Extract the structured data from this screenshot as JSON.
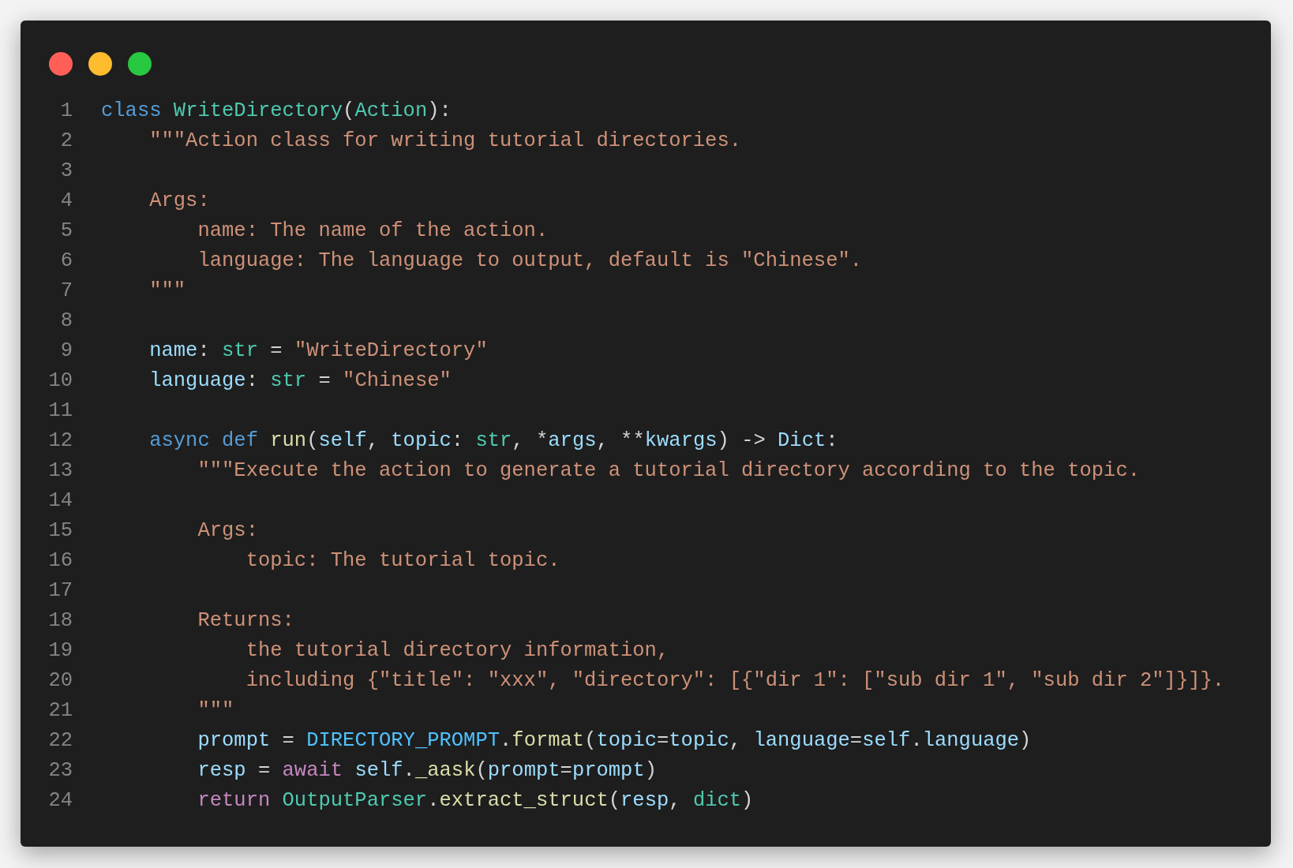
{
  "window": {
    "controls": [
      {
        "kind": "close"
      },
      {
        "kind": "minimize"
      },
      {
        "kind": "zoom"
      }
    ]
  },
  "lines": [
    {
      "number": "1",
      "tokens": [
        {
          "kind": "keyword",
          "text": "class "
        },
        {
          "kind": "class",
          "text": "WriteDirectory"
        },
        {
          "kind": "plain",
          "text": "("
        },
        {
          "kind": "class",
          "text": "Action"
        },
        {
          "kind": "plain",
          "text": "):"
        }
      ]
    },
    {
      "number": "2",
      "tokens": [
        {
          "kind": "string",
          "text": "    \"\"\"Action class for writing tutorial directories."
        }
      ]
    },
    {
      "number": "3"
    },
    {
      "number": "4",
      "tokens": [
        {
          "kind": "string",
          "text": "    Args:"
        }
      ]
    },
    {
      "number": "5",
      "tokens": [
        {
          "kind": "string",
          "text": "        name: The name of the action."
        }
      ]
    },
    {
      "number": "6",
      "tokens": [
        {
          "kind": "string",
          "text": "        language: The language to output, default is \"Chinese\"."
        }
      ]
    },
    {
      "number": "7",
      "tokens": [
        {
          "kind": "string",
          "text": "    \"\"\""
        }
      ]
    },
    {
      "number": "8"
    },
    {
      "number": "9",
      "tokens": [
        {
          "kind": "variable",
          "text": "    name"
        },
        {
          "kind": "plain",
          "text": ": "
        },
        {
          "kind": "type",
          "text": "str"
        },
        {
          "kind": "plain",
          "text": " = "
        },
        {
          "kind": "string",
          "text": "\"WriteDirectory\""
        }
      ]
    },
    {
      "number": "10",
      "tokens": [
        {
          "kind": "variable",
          "text": "    language"
        },
        {
          "kind": "plain",
          "text": ": "
        },
        {
          "kind": "type",
          "text": "str"
        },
        {
          "kind": "plain",
          "text": " = "
        },
        {
          "kind": "string",
          "text": "\"Chinese\""
        }
      ]
    },
    {
      "number": "11"
    },
    {
      "number": "12",
      "tokens": [
        {
          "kind": "keyword",
          "text": "    async def "
        },
        {
          "kind": "function",
          "text": "run"
        },
        {
          "kind": "plain",
          "text": "("
        },
        {
          "kind": "variable",
          "text": "self"
        },
        {
          "kind": "plain",
          "text": ", "
        },
        {
          "kind": "variable",
          "text": "topic"
        },
        {
          "kind": "plain",
          "text": ": "
        },
        {
          "kind": "type",
          "text": "str"
        },
        {
          "kind": "plain",
          "text": ", *"
        },
        {
          "kind": "variable",
          "text": "args"
        },
        {
          "kind": "plain",
          "text": ", **"
        },
        {
          "kind": "variable",
          "text": "kwargs"
        },
        {
          "kind": "plain",
          "text": ") -> "
        },
        {
          "kind": "variable",
          "text": "Dict"
        },
        {
          "kind": "plain",
          "text": ":"
        }
      ]
    },
    {
      "number": "13",
      "tokens": [
        {
          "kind": "string",
          "text": "        \"\"\"Execute the action to generate a tutorial directory according to the topic."
        }
      ]
    },
    {
      "number": "14"
    },
    {
      "number": "15",
      "tokens": [
        {
          "kind": "string",
          "text": "        Args:"
        }
      ]
    },
    {
      "number": "16",
      "tokens": [
        {
          "kind": "string",
          "text": "            topic: The tutorial topic."
        }
      ]
    },
    {
      "number": "17"
    },
    {
      "number": "18",
      "tokens": [
        {
          "kind": "string",
          "text": "        Returns:"
        }
      ]
    },
    {
      "number": "19",
      "tokens": [
        {
          "kind": "string",
          "text": "            the tutorial directory information,"
        }
      ]
    },
    {
      "number": "20",
      "tokens": [
        {
          "kind": "string",
          "text": "            including {\"title\": \"xxx\", \"directory\": [{\"dir 1\": [\"sub dir 1\", \"sub dir 2\"]}]}."
        }
      ]
    },
    {
      "number": "21",
      "tokens": [
        {
          "kind": "string",
          "text": "        \"\"\""
        }
      ]
    },
    {
      "number": "22",
      "tokens": [
        {
          "kind": "variable",
          "text": "        prompt"
        },
        {
          "kind": "plain",
          "text": " = "
        },
        {
          "kind": "constant",
          "text": "DIRECTORY_PROMPT"
        },
        {
          "kind": "plain",
          "text": "."
        },
        {
          "kind": "function",
          "text": "format"
        },
        {
          "kind": "plain",
          "text": "("
        },
        {
          "kind": "variable",
          "text": "topic"
        },
        {
          "kind": "plain",
          "text": "="
        },
        {
          "kind": "variable",
          "text": "topic"
        },
        {
          "kind": "plain",
          "text": ", "
        },
        {
          "kind": "variable",
          "text": "language"
        },
        {
          "kind": "plain",
          "text": "="
        },
        {
          "kind": "variable",
          "text": "self"
        },
        {
          "kind": "plain",
          "text": "."
        },
        {
          "kind": "variable",
          "text": "language"
        },
        {
          "kind": "plain",
          "text": ")"
        }
      ]
    },
    {
      "number": "23",
      "tokens": [
        {
          "kind": "variable",
          "text": "        resp"
        },
        {
          "kind": "plain",
          "text": " = "
        },
        {
          "kind": "control",
          "text": "await "
        },
        {
          "kind": "variable",
          "text": "self"
        },
        {
          "kind": "plain",
          "text": "."
        },
        {
          "kind": "function",
          "text": "_aask"
        },
        {
          "kind": "plain",
          "text": "("
        },
        {
          "kind": "variable",
          "text": "prompt"
        },
        {
          "kind": "plain",
          "text": "="
        },
        {
          "kind": "variable",
          "text": "prompt"
        },
        {
          "kind": "plain",
          "text": ")"
        }
      ]
    },
    {
      "number": "24",
      "tokens": [
        {
          "kind": "control",
          "text": "        return "
        },
        {
          "kind": "class",
          "text": "OutputParser"
        },
        {
          "kind": "plain",
          "text": "."
        },
        {
          "kind": "function",
          "text": "extract_struct"
        },
        {
          "kind": "plain",
          "text": "("
        },
        {
          "kind": "variable",
          "text": "resp"
        },
        {
          "kind": "plain",
          "text": ", "
        },
        {
          "kind": "type",
          "text": "dict"
        },
        {
          "kind": "plain",
          "text": ")"
        }
      ]
    }
  ]
}
